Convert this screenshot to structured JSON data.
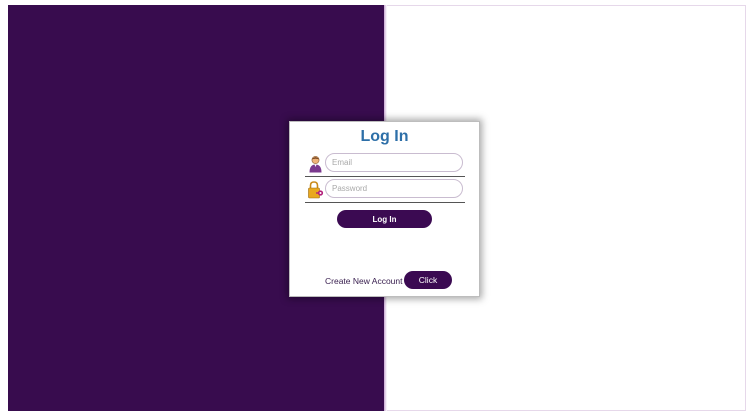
{
  "login": {
    "title": "Log In",
    "email": {
      "placeholder": "Email",
      "value": "",
      "icon": "user-icon"
    },
    "password": {
      "placeholder": "Password",
      "value": "",
      "icon": "key-lock-icon"
    },
    "submit_label": "Log In",
    "create_account_label": "Create New Account",
    "create_account_button": "Click"
  },
  "colors": {
    "brand_purple": "#380c4e",
    "title_blue": "#2d6fa8",
    "background": "#ffffff"
  }
}
